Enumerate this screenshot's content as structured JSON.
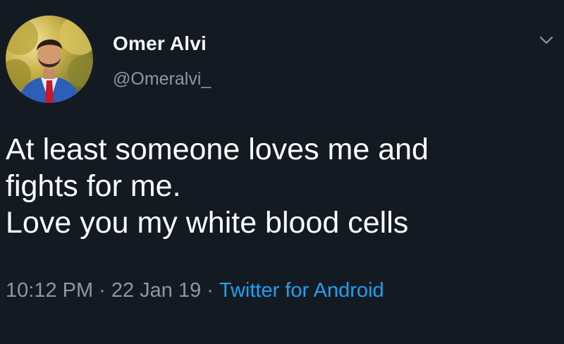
{
  "author": {
    "display_name": "Omer Alvi",
    "handle": "@Omeralvi_"
  },
  "icons": {
    "menu": "chevron-down-icon",
    "avatar": "profile-photo"
  },
  "tweet": {
    "lines": [
      "At least someone loves me and",
      "fights for me.",
      "Love you my white blood cells"
    ],
    "time": "10:12 PM",
    "date": "22 Jan 19",
    "separator": "·",
    "source": "Twitter for Android"
  },
  "colors": {
    "background": "#141a22",
    "text_primary": "#ffffff",
    "text_secondary": "#8b98a5",
    "link": "#1da1f2"
  }
}
